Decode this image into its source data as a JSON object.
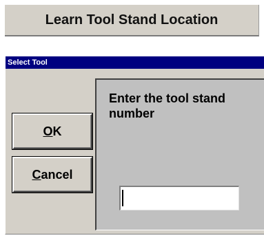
{
  "header": {
    "title": "Learn Tool Stand Location"
  },
  "dialog": {
    "title": "Select Tool",
    "buttons": {
      "ok": {
        "mnemonic": "O",
        "rest": "K"
      },
      "cancel": {
        "mnemonic": "C",
        "rest": "ancel"
      }
    },
    "prompt": "Enter the tool stand number",
    "input": {
      "value": "",
      "placeholder": ""
    }
  },
  "colors": {
    "titlebar": "#000080",
    "face": "#d4d0c8",
    "panel": "#c0c0c0"
  }
}
